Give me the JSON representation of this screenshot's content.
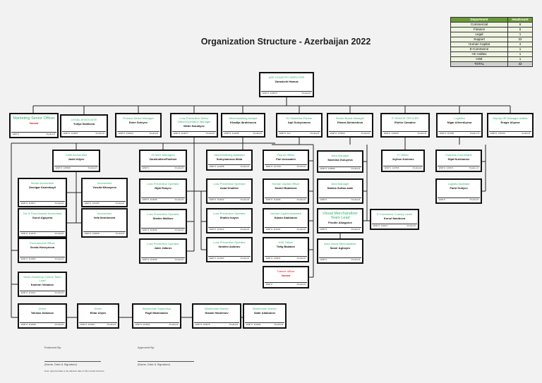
{
  "title": "Organization Structure - Azerbaijan 2022",
  "summary": {
    "headers": [
      "Department",
      "Headcount"
    ],
    "rows": [
      {
        "dept": "Commercial",
        "count": "6"
      },
      {
        "dept": "Finance",
        "count": "6"
      },
      {
        "dept": "Legal",
        "count": "1"
      },
      {
        "dept": "Support",
        "count": "22"
      },
      {
        "dept": "Human Capital",
        "count": "4"
      },
      {
        "dept": "E-Commerce",
        "count": "1"
      },
      {
        "dept": "HC Inditex",
        "count": "1"
      },
      {
        "dept": "HSE",
        "count": "1"
      }
    ],
    "total": {
      "dept": "TOTAL",
      "count": "42"
    }
  },
  "boxes": [
    {
      "title": "AZE COUNTRY DIRECTOR",
      "name": "Zarasbcht Hamza",
      "emp": "EMP #: 130679",
      "pos": "Position#"
    },
    {
      "title": "Marketing Senior Officer",
      "name": "Vacant",
      "emp": "EMP #",
      "pos": "Position#",
      "vacant": true,
      "big": true
    },
    {
      "title": "LEGAL ASSOCIATE",
      "name": "Yuliya Sadikova",
      "emp": "EMP #: 110687",
      "pos": "Position#"
    },
    {
      "title": "Finance Senior Manager",
      "name": "Emin Suleyev",
      "emp": "EMP #: 130633",
      "pos": "Position#"
    },
    {
      "title": "Loss Prevention Senior Officer/Operation Manager",
      "name": "Metin Nuraliyev",
      "emp": "EMP #: 110077",
      "pos": "Position#"
    },
    {
      "title": "Merchandising Analyst",
      "name": "Khadija Ibrahimova",
      "emp": "EMP #: 112008",
      "pos": "Position#"
    },
    {
      "title": "HC Business Partner",
      "name": "Aqil Suleymanov",
      "emp": "EMP #: 110",
      "pos": "Position#"
    },
    {
      "title": "Senior Brand Manager",
      "name": "Elnara Akhmedova",
      "emp": "EMP #: 130360",
      "pos": "Position#"
    },
    {
      "title": "IT SENIOR OFFICER",
      "name": "Elshin Camalov",
      "emp": "EMP #: 130240",
      "pos": "Position#"
    },
    {
      "title": "Logistics",
      "name": "Nigar Allverdiyeva",
      "emp": "EMP #: 111066",
      "pos": "Position #"
    },
    {
      "title": "Deputy HR Manager Inditex",
      "name": "Eragiz Aliyeva",
      "emp": "EMP #: 130700",
      "pos": "position#"
    },
    {
      "title": "Chief Accountant",
      "name": "Javid Aliyev",
      "emp": "EMP #: 125698",
      "pos": "Position#"
    },
    {
      "title": "Senior Accountant",
      "name": "Zarnigar Kazimbayli",
      "emp": "EMP #: 110517",
      "pos": "Position#"
    },
    {
      "title": "Accountant",
      "name": "Yusufa Mirzayeva",
      "emp": "EMP #: 121005",
      "pos": "Position#"
    },
    {
      "title": "Tax & Fixed Assets Accountant",
      "name": "Gunel Agayeva",
      "emp": "EMP #: 110278",
      "pos": "Position#"
    },
    {
      "title": "Accountant",
      "name": "Vefa Ibrahimova",
      "emp": "EMP #: 129538",
      "pos": "Position#"
    },
    {
      "title": "Procurement Officer",
      "name": "Sevda Huseynova",
      "emp": "EMP #: 110383",
      "pos": "Position#"
    },
    {
      "title": "Stock /Inventory Control Team Lead",
      "name": "Kamran Vahabov",
      "emp": "EMP #: 110114",
      "pos": "Position#"
    },
    {
      "title": "29 store Managers",
      "name": "Zara/Inditex/Fashion",
      "emp": "EMP #",
      "pos": "Position#"
    },
    {
      "title": "Loss Prevention Operator",
      "name": "Nijat Rzayev",
      "emp": "EMP #: 110028",
      "pos": "Position#"
    },
    {
      "title": "Loss Prevention Operator",
      "name": "Shahin Malikov",
      "emp": "EMP #: 110036",
      "pos": "Position#"
    },
    {
      "title": "Loss Prevention Operator",
      "name": "Jabir Jafarov",
      "emp": "EMP #: 110048",
      "pos": "Position#"
    },
    {
      "title": "Merchandising Assistant",
      "name": "Suleymanova Ittida",
      "emp": "EMP #: 112068",
      "pos": "Position#"
    },
    {
      "title": "Loss Prevention Operator",
      "name": "Azad Khalilov",
      "emp": "EMP #: 110029",
      "pos": "Position#"
    },
    {
      "title": "Loss Prevention Operator",
      "name": "Shahin Isayev",
      "emp": "EMP #: 110313",
      "pos": "Position#"
    },
    {
      "title": "Loss Prevention Operator",
      "name": "Ibrahim Aslanov",
      "emp": "EMP #: 110320",
      "pos": "Position#"
    },
    {
      "title": "Payroll Officer",
      "name": "Pari Azizzadeh",
      "emp": "EMP #: 127128",
      "pos": "Position#"
    },
    {
      "title": "Human Capital Officer",
      "name": "Daniel Badalova",
      "emp": "EMP #: 110296",
      "pos": "Position#"
    },
    {
      "title": "Human Capital Assistant",
      "name": "Kanan Alakbarov",
      "emp": "EMP #: 111004",
      "pos": "Position#"
    },
    {
      "title": "HSE Officer",
      "name": "Tofig Badalov",
      "emp": "EMP #: 130031",
      "pos": "Position#"
    },
    {
      "title": "Trainee officer",
      "name": "Vacant",
      "emp": "EMP #",
      "pos": "Position#",
      "vacant": true,
      "redtitle": true
    },
    {
      "title": "Area Manager",
      "name": "Narmina Guluyeva",
      "emp": "EMP #: 130896",
      "pos": "Position#"
    },
    {
      "title": "Area Manager",
      "name": "Sabina Sultan-zade",
      "emp": "EMP #",
      "pos": "Position#"
    },
    {
      "title": "Visual Merchandiser Team Lead",
      "name": "Firudin Alasgarov",
      "emp": "EMP #",
      "pos": "Position#",
      "big": true
    },
    {
      "title": "Area Visual Merchandiser",
      "name": "Samir Aghayev",
      "emp": "EMP #",
      "pos": "Position#"
    },
    {
      "title": "IT Officer",
      "name": "Jeyhun Karimov",
      "emp": "EMP #: 121556",
      "pos": "Position#"
    },
    {
      "title": "E-Commerce Country Lead/",
      "name": "Konul Nasibova",
      "emp": "EMP #: 130117",
      "pos": "Position#"
    },
    {
      "title": "Customs Coordinator",
      "name": "Nijat Nurimanov",
      "emp": "EMP #: 130071",
      "pos": "Position #"
    },
    {
      "title": "Logistic Assistant",
      "name": "Farid Guliyev",
      "emp": "EMP #",
      "pos": "Position#"
    },
    {
      "title": "Driver",
      "name": "Tahmaz Abbasov",
      "emp": "EMP #: 112008",
      "pos": "Position#"
    },
    {
      "title": "Driver",
      "name": "Eldar Aliyev",
      "emp": "EMP #: 110287",
      "pos": "Position#"
    },
    {
      "title": "Warehouse Supervisor",
      "name": "Fagil Mammadov",
      "emp": "EMP #: 110644",
      "pos": "Position#"
    },
    {
      "title": "Warehouse Worker",
      "name": "Nizami Hashimov",
      "emp": "EMP #: 110675",
      "pos": "Position#"
    },
    {
      "title": "Warehouse Worker",
      "name": "Sabir Alakbarov",
      "emp": "EMP #: 110294",
      "pos": "Position#"
    }
  ],
  "footer": {
    "endorsed": "Endorsed By:",
    "approved": "Approved By:",
    "sig1": "(Name, Date & Signature)",
    "sig2": "(Name, Date & Signature)",
    "note": "Note: approval date is the effective date of this revised structure"
  }
}
